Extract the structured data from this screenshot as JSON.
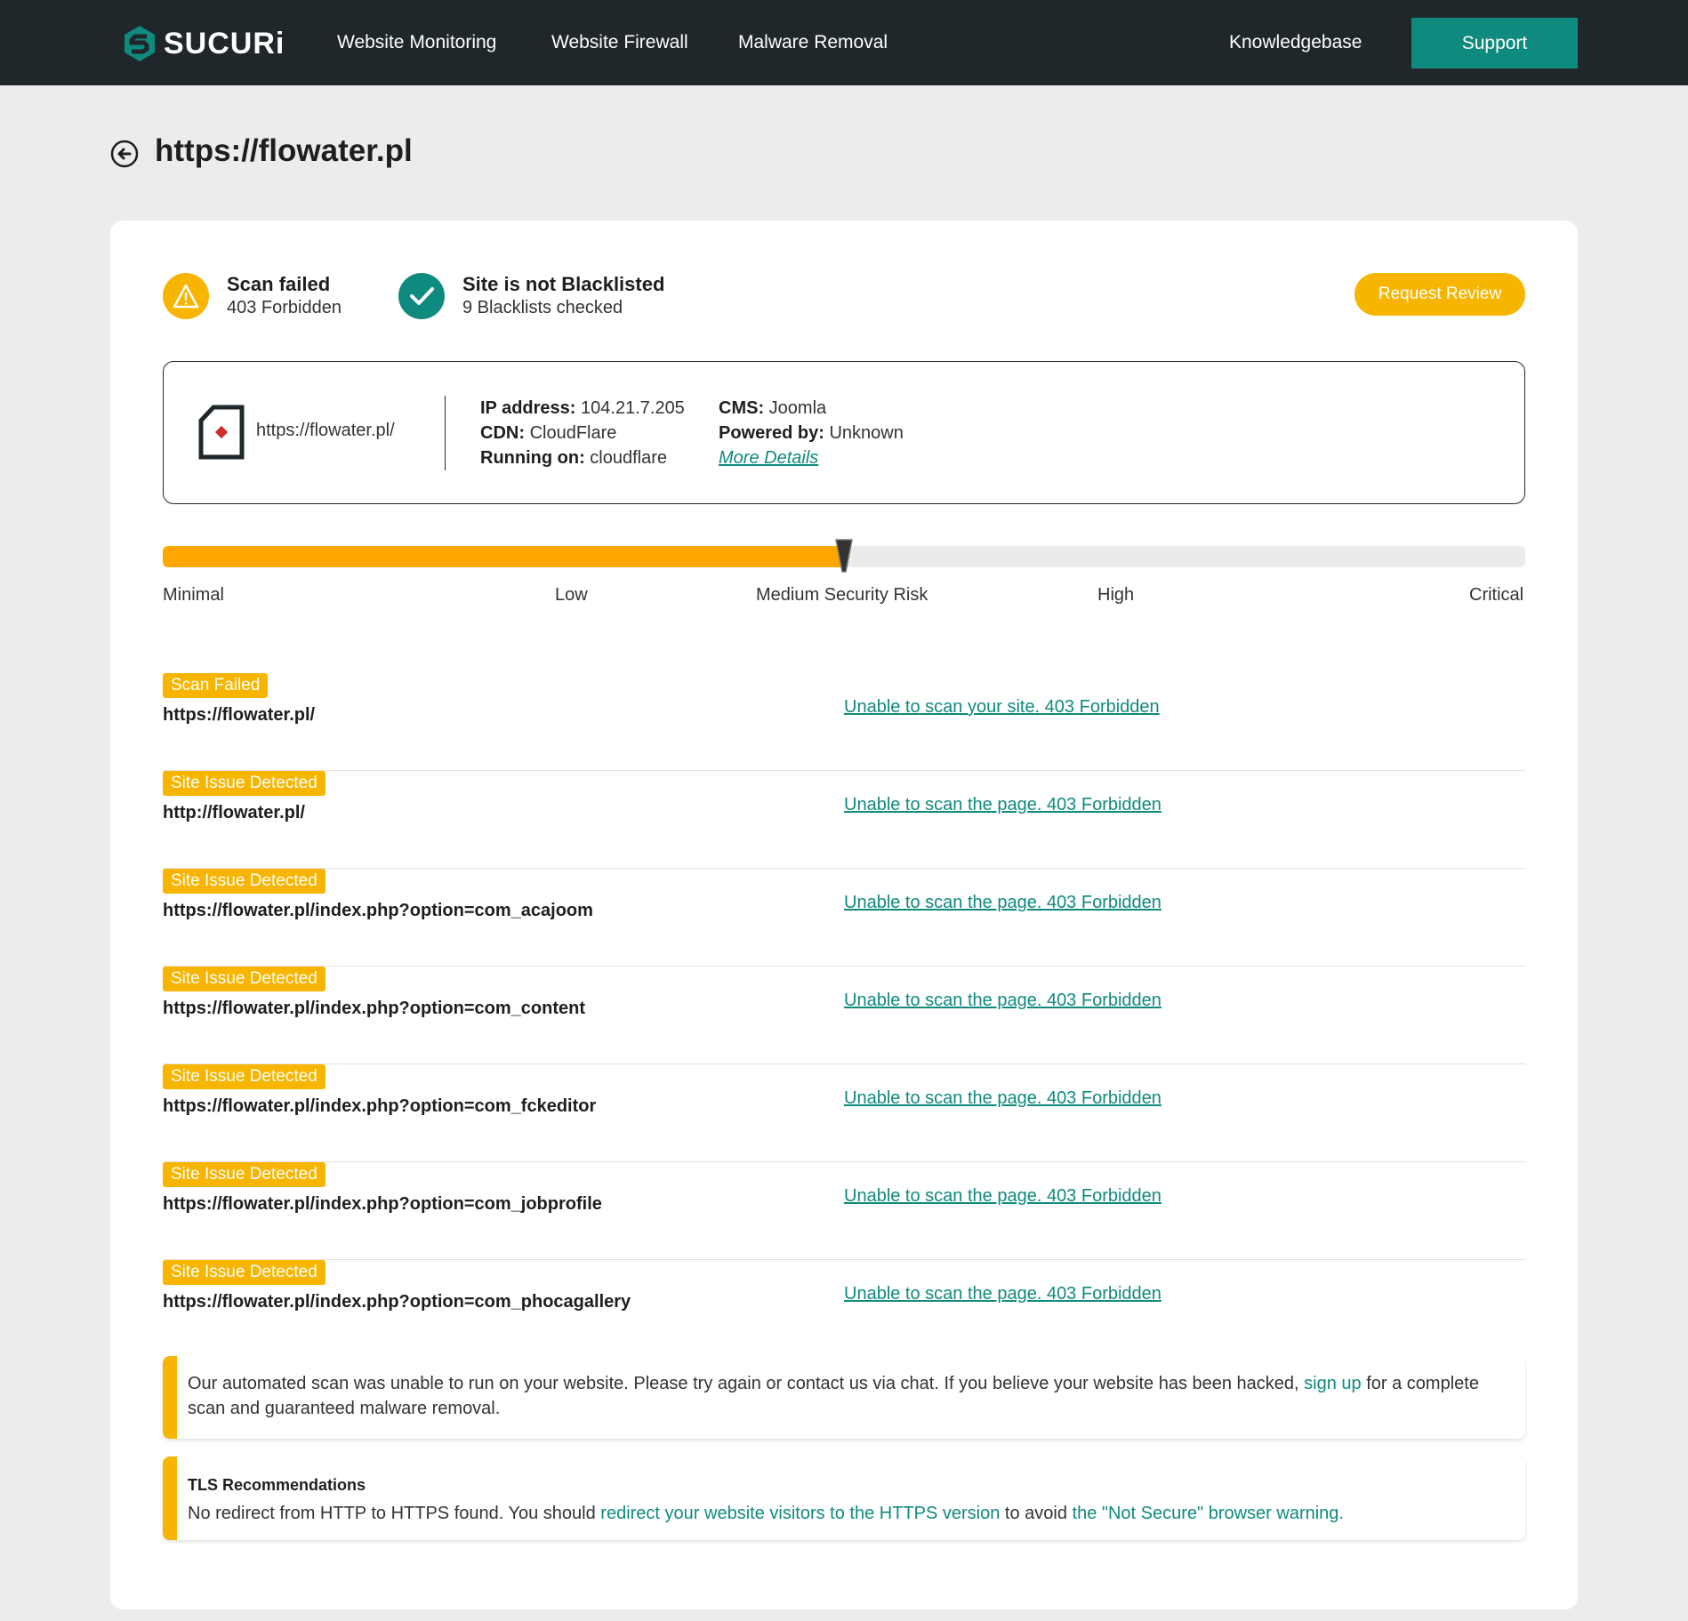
{
  "brand": {
    "name": "SUCURi",
    "accent": "#0f8a7e",
    "warning": "#f7b500",
    "risk_fill": "#ffa600",
    "nav_bg": "#1f272b"
  },
  "nav": {
    "links": [
      "Website Monitoring",
      "Website Firewall",
      "Malware Removal"
    ],
    "knowledgebase": "Knowledgebase",
    "support": "Support"
  },
  "page": {
    "title": "https://flowater.pl"
  },
  "status": {
    "scan": {
      "title": "Scan failed",
      "detail": "403 Forbidden",
      "icon": "warning-icon"
    },
    "blacklist": {
      "title": "Site is not Blacklisted",
      "detail": "9 Blacklists checked",
      "icon": "check-icon"
    },
    "request_review": "Request Review"
  },
  "site_info": {
    "url": "https://flowater.pl/",
    "ip_label": "IP address:",
    "ip": "104.21.7.205",
    "cdn_label": "CDN:",
    "cdn": "CloudFlare",
    "running_label": "Running on:",
    "running": "cloudflare",
    "cms_label": "CMS:",
    "cms": "Joomla",
    "powered_label": "Powered by:",
    "powered": "Unknown",
    "more_details": "More Details"
  },
  "risk": {
    "level_fraction": 0.5,
    "labels": [
      "Minimal",
      "Low",
      "Medium Security Risk",
      "High",
      "Critical"
    ]
  },
  "results": [
    {
      "badge": "Scan Failed",
      "url": "https://flowater.pl/",
      "message": "Unable to scan your site. 403 Forbidden"
    },
    {
      "badge": "Site Issue Detected",
      "url": "http://flowater.pl/",
      "message": "Unable to scan the page. 403 Forbidden"
    },
    {
      "badge": "Site Issue Detected",
      "url": "https://flowater.pl/index.php?option=com_acajoom",
      "message": "Unable to scan the page. 403 Forbidden"
    },
    {
      "badge": "Site Issue Detected",
      "url": "https://flowater.pl/index.php?option=com_content",
      "message": "Unable to scan the page. 403 Forbidden"
    },
    {
      "badge": "Site Issue Detected",
      "url": "https://flowater.pl/index.php?option=com_fckeditor",
      "message": "Unable to scan the page. 403 Forbidden"
    },
    {
      "badge": "Site Issue Detected",
      "url": "https://flowater.pl/index.php?option=com_jobprofile",
      "message": "Unable to scan the page. 403 Forbidden"
    },
    {
      "badge": "Site Issue Detected",
      "url": "https://flowater.pl/index.php?option=com_phocagallery",
      "message": "Unable to scan the page. 403 Forbidden"
    }
  ],
  "notice_scan": {
    "text_before": "Our automated scan was unable to run on your website. Please try again or contact us via chat. If you believe your website has been hacked,",
    "link": "sign up",
    "text_after": "for a complete scan and guaranteed malware removal."
  },
  "notice_tls": {
    "title": "TLS Recommendations",
    "text_before": "No redirect from HTTP to HTTPS found. You should",
    "link1": "redirect your website visitors to the HTTPS version",
    "text_mid": "to avoid",
    "link2": "the \"Not Secure\" browser warning."
  }
}
